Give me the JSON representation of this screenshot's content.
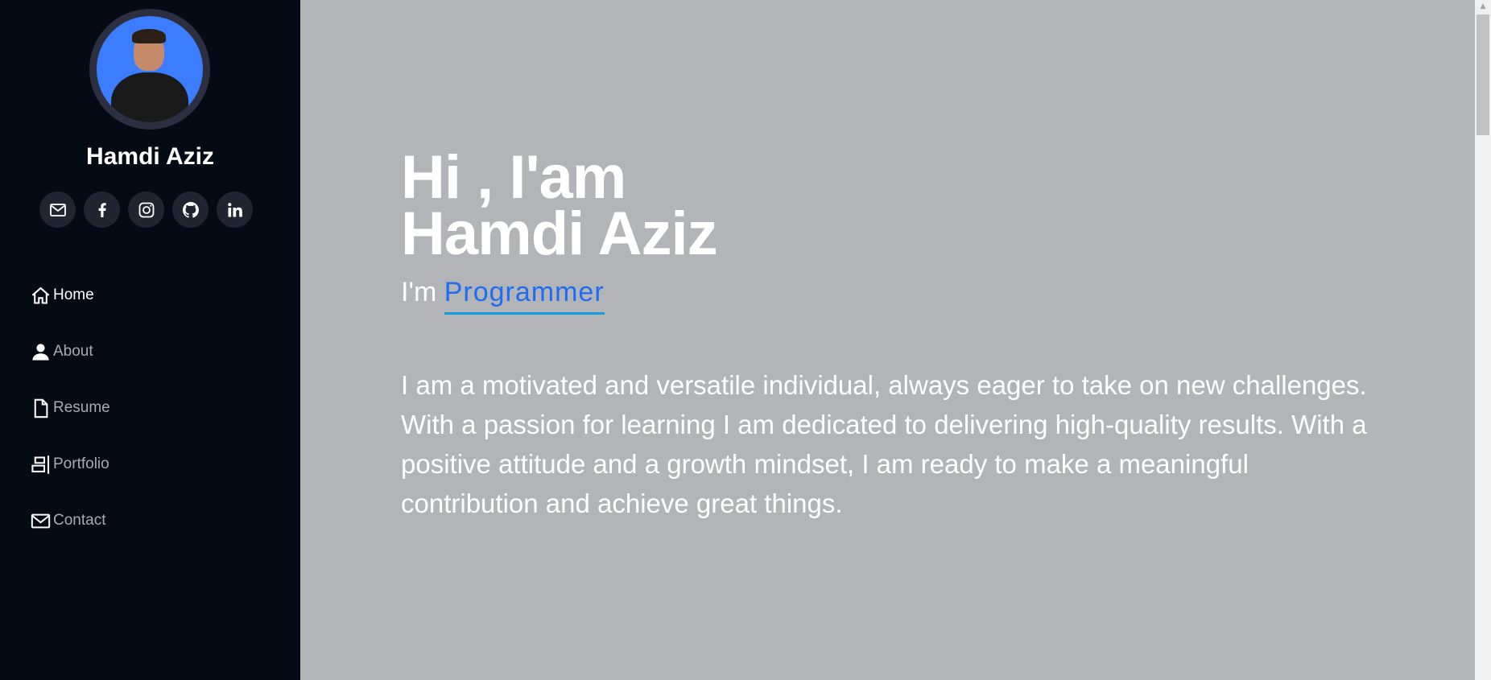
{
  "sidebar": {
    "profile_name": "Hamdi Aziz",
    "socials": [
      {
        "name": "email",
        "icon": "mail-icon"
      },
      {
        "name": "facebook",
        "icon": "facebook-icon"
      },
      {
        "name": "instagram",
        "icon": "instagram-icon"
      },
      {
        "name": "github",
        "icon": "github-icon"
      },
      {
        "name": "linkedin",
        "icon": "linkedin-icon"
      }
    ],
    "nav": [
      {
        "label": "Home",
        "icon": "home-icon",
        "active": true
      },
      {
        "label": "About",
        "icon": "person-icon",
        "active": false
      },
      {
        "label": "Resume",
        "icon": "file-icon",
        "active": false
      },
      {
        "label": "Portfolio",
        "icon": "portfolio-icon",
        "active": false
      },
      {
        "label": "Contact",
        "icon": "envelope-icon",
        "active": false
      }
    ]
  },
  "hero": {
    "greeting": "Hi , I'am",
    "name": "Hamdi Aziz",
    "typed_prefix": "I'm",
    "typed_role": "Programmer",
    "bio": "I am a motivated and versatile individual, always eager to take on new challenges. With a passion for learning I am dedicated to delivering high-quality results. With a positive attitude and a growth mindset, I am ready to make a meaningful contribution and achieve great things."
  },
  "colors": {
    "sidebar_bg": "#040b14",
    "main_bg": "#b3b4b8",
    "accent": "#1f6cf0",
    "underline": "#149ddd"
  }
}
